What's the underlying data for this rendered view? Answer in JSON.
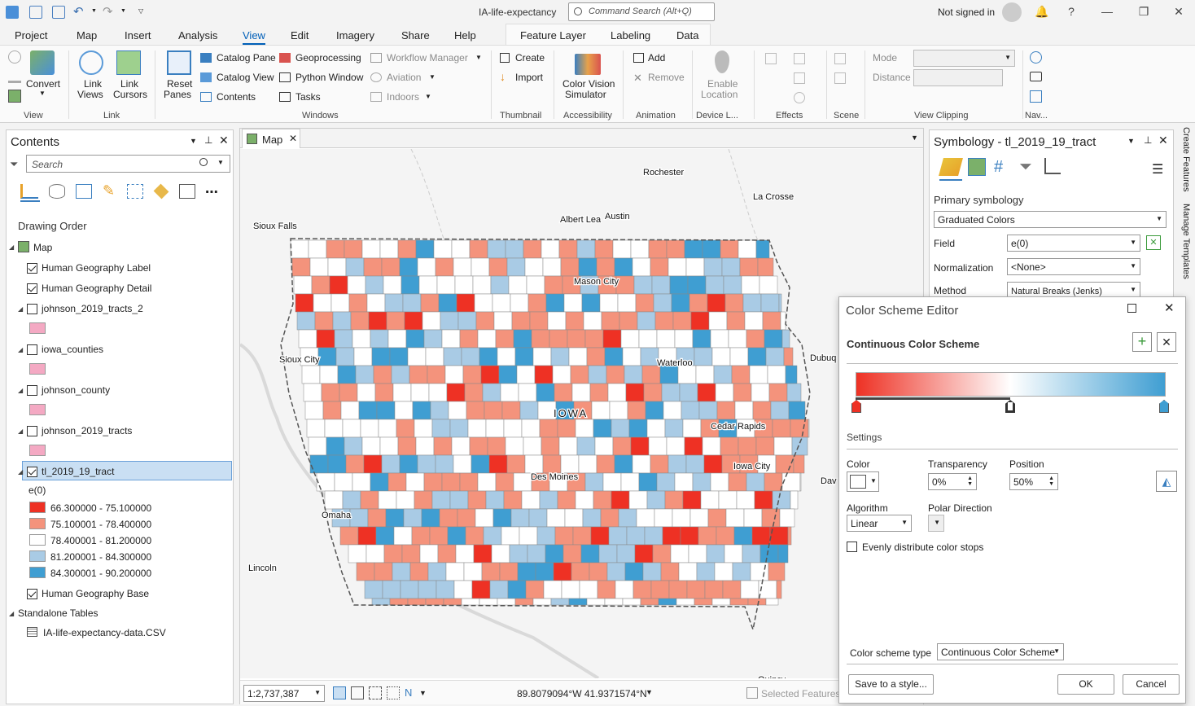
{
  "app": {
    "title": "IA-life-expectancy",
    "command_search_placeholder": "Command Search (Alt+Q)",
    "signed_in_text": "Not signed in"
  },
  "tabs": [
    {
      "label": "Project"
    },
    {
      "label": "Map"
    },
    {
      "label": "Insert"
    },
    {
      "label": "Analysis"
    },
    {
      "label": "View",
      "active": true
    },
    {
      "label": "Edit"
    },
    {
      "label": "Imagery"
    },
    {
      "label": "Share"
    },
    {
      "label": "Help"
    },
    {
      "label": "Feature Layer"
    },
    {
      "label": "Labeling"
    },
    {
      "label": "Data"
    }
  ],
  "ribbon": {
    "view": {
      "convert": "Convert",
      "group": "View"
    },
    "link": {
      "link_views": "Link",
      "link_views2": "Views",
      "link_cursors": "Link",
      "link_cursors2": "Cursors",
      "group": "Link"
    },
    "windows": {
      "reset_panes": "Reset",
      "reset_panes2": "Panes",
      "catalog_pane": "Catalog Pane",
      "catalog_view": "Catalog View",
      "contents": "Contents",
      "geoprocessing": "Geoprocessing",
      "python_window": "Python Window",
      "tasks": "Tasks",
      "workflow_manager": "Workflow Manager",
      "aviation": "Aviation",
      "indoors": "Indoors",
      "group": "Windows"
    },
    "thumbnail": {
      "create": "Create",
      "import": "Import",
      "group": "Thumbnail"
    },
    "accessibility": {
      "cvs": "Color Vision",
      "cvs2": "Simulator",
      "group": "Accessibility"
    },
    "animation": {
      "add": "Add",
      "remove": "Remove",
      "group": "Animation"
    },
    "device": {
      "enable_location": "Enable",
      "enable_location2": "Location",
      "group": "Device L..."
    },
    "effects": {
      "group": "Effects"
    },
    "scene": {
      "group": "Scene"
    },
    "clipping": {
      "mode": "Mode",
      "distance": "Distance",
      "group": "View Clipping"
    },
    "nav": {
      "group": "Nav..."
    }
  },
  "contents": {
    "title": "Contents",
    "search_placeholder": "Search",
    "drawing_order": "Drawing Order",
    "layers": [
      {
        "name": "Map",
        "type": "map"
      },
      {
        "name": "Human Geography Label",
        "checked": true
      },
      {
        "name": "Human Geography Detail",
        "checked": true
      },
      {
        "name": "johnson_2019_tracts_2",
        "checked": false,
        "swatch": "#f4a9c3"
      },
      {
        "name": "iowa_counties",
        "checked": false,
        "swatch": "#f4a9c3"
      },
      {
        "name": "johnson_county",
        "checked": false,
        "swatch": "#f4a9c3"
      },
      {
        "name": "johnson_2019_tracts",
        "checked": false,
        "swatch": "#f4a9c3"
      },
      {
        "name": "tl_2019_19_tract",
        "checked": true,
        "selected": true
      }
    ],
    "legend_field": "e(0)",
    "classes": [
      {
        "label": "66.300000 - 75.100000",
        "color": "#ee3124"
      },
      {
        "label": "75.100001 - 78.400000",
        "color": "#f4937c"
      },
      {
        "label": "78.400001 - 81.200000",
        "color": "#ffffff"
      },
      {
        "label": "81.200001 - 84.300000",
        "color": "#a9cbe5"
      },
      {
        "label": "84.300001 - 90.200000",
        "color": "#3f9ed2"
      }
    ],
    "base": {
      "name": "Human Geography Base",
      "checked": true
    },
    "standalone": "Standalone Tables",
    "table": "IA-life-expectancy-data.CSV"
  },
  "map": {
    "tab": "Map",
    "labels": [
      "Rochester",
      "La Crosse",
      "Sioux Falls",
      "Albert Lea",
      "Austin",
      "Mason City",
      "Sioux City",
      "Waterloo",
      "Dubuq",
      "IOWA",
      "Cedar Rapids",
      "Iowa City",
      "Des Moines",
      "Dav",
      "Omaha",
      "Lincoln",
      "Quincy"
    ],
    "scale": "1:2,737,387",
    "coords": "89.8079094°W 41.9371574°N",
    "selected_features": "Selected Features:"
  },
  "symbology": {
    "title": "Symbology - tl_2019_19_tract",
    "primary": "Primary symbology",
    "renderer": "Graduated Colors",
    "field_label": "Field",
    "field": "e(0)",
    "normalization_label": "Normalization",
    "normalization": "<None>",
    "method_label": "Method",
    "method": "Natural Breaks (Jenks)"
  },
  "side_strip": [
    "Create Features",
    "Manage Templates"
  ],
  "color_scheme_editor": {
    "title": "Color Scheme Editor",
    "subtitle": "Continuous Color Scheme",
    "gradient": [
      "#ee3124",
      "#ffffff",
      "#3f9ed2"
    ],
    "settings": "Settings",
    "color_label": "Color",
    "transparency_label": "Transparency",
    "transparency": "0%",
    "position_label": "Position",
    "position": "50%",
    "algorithm_label": "Algorithm",
    "algorithm": "Linear",
    "polar_label": "Polar Direction",
    "evenly": "Evenly distribute color stops",
    "scheme_type_label": "Color scheme type",
    "scheme_type": "Continuous Color Scheme",
    "save": "Save to a style...",
    "ok": "OK",
    "cancel": "Cancel"
  }
}
